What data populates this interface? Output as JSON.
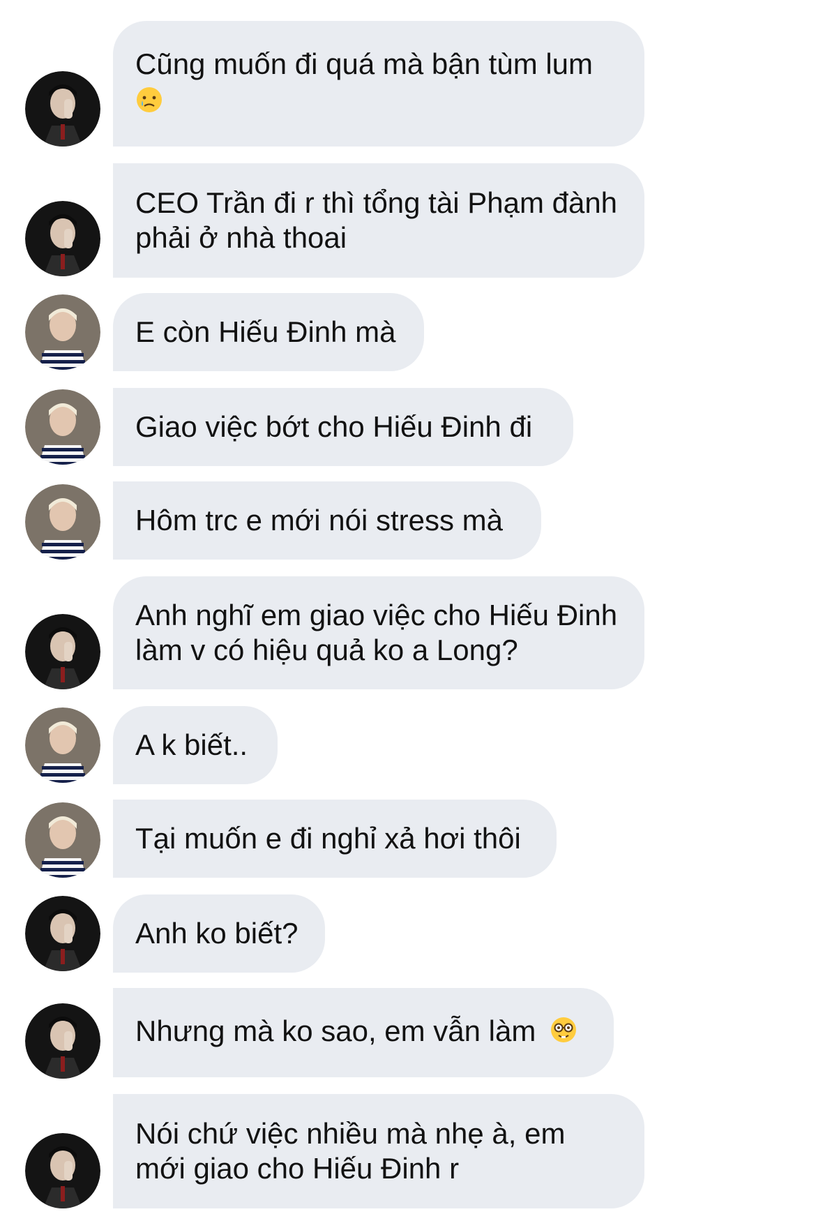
{
  "conversation": {
    "messages": [
      {
        "sender": "ceo-avatar",
        "text": "Cũng muốn đi quá mà bận tùm lum",
        "emoji": "crying-face"
      },
      {
        "sender": "ceo-avatar",
        "text": "CEO Trần đi r thì tổng tài Phạm đành phải ở nhà thoai"
      },
      {
        "sender": "blonde-avatar",
        "text": "E còn Hiếu Đinh mà"
      },
      {
        "sender": "blonde-avatar",
        "text": "Giao việc bớt cho Hiếu Đinh đi"
      },
      {
        "sender": "blonde-avatar",
        "text": "Hôm trc e mới nói stress mà"
      },
      {
        "sender": "ceo-avatar",
        "text": "Anh nghĩ em giao việc cho Hiếu Đinh làm v có hiệu quả ko a Long?"
      },
      {
        "sender": "blonde-avatar",
        "text": "A k biết.."
      },
      {
        "sender": "blonde-avatar",
        "text": "Tại muốn e đi nghỉ xả hơi thôi"
      },
      {
        "sender": "ceo-avatar",
        "text": "Anh ko biết?"
      },
      {
        "sender": "ceo-avatar",
        "text": "Nhưng mà ko sao, em vẫn làm",
        "emoji": "nerd-face"
      },
      {
        "sender": "ceo-avatar",
        "text": "Nói chứ việc nhiều mà nhẹ à, em mới giao cho Hiếu Đinh r"
      }
    ]
  },
  "colors": {
    "bubble": "#e9ecf1",
    "text": "#121212",
    "background": "#ffffff"
  }
}
